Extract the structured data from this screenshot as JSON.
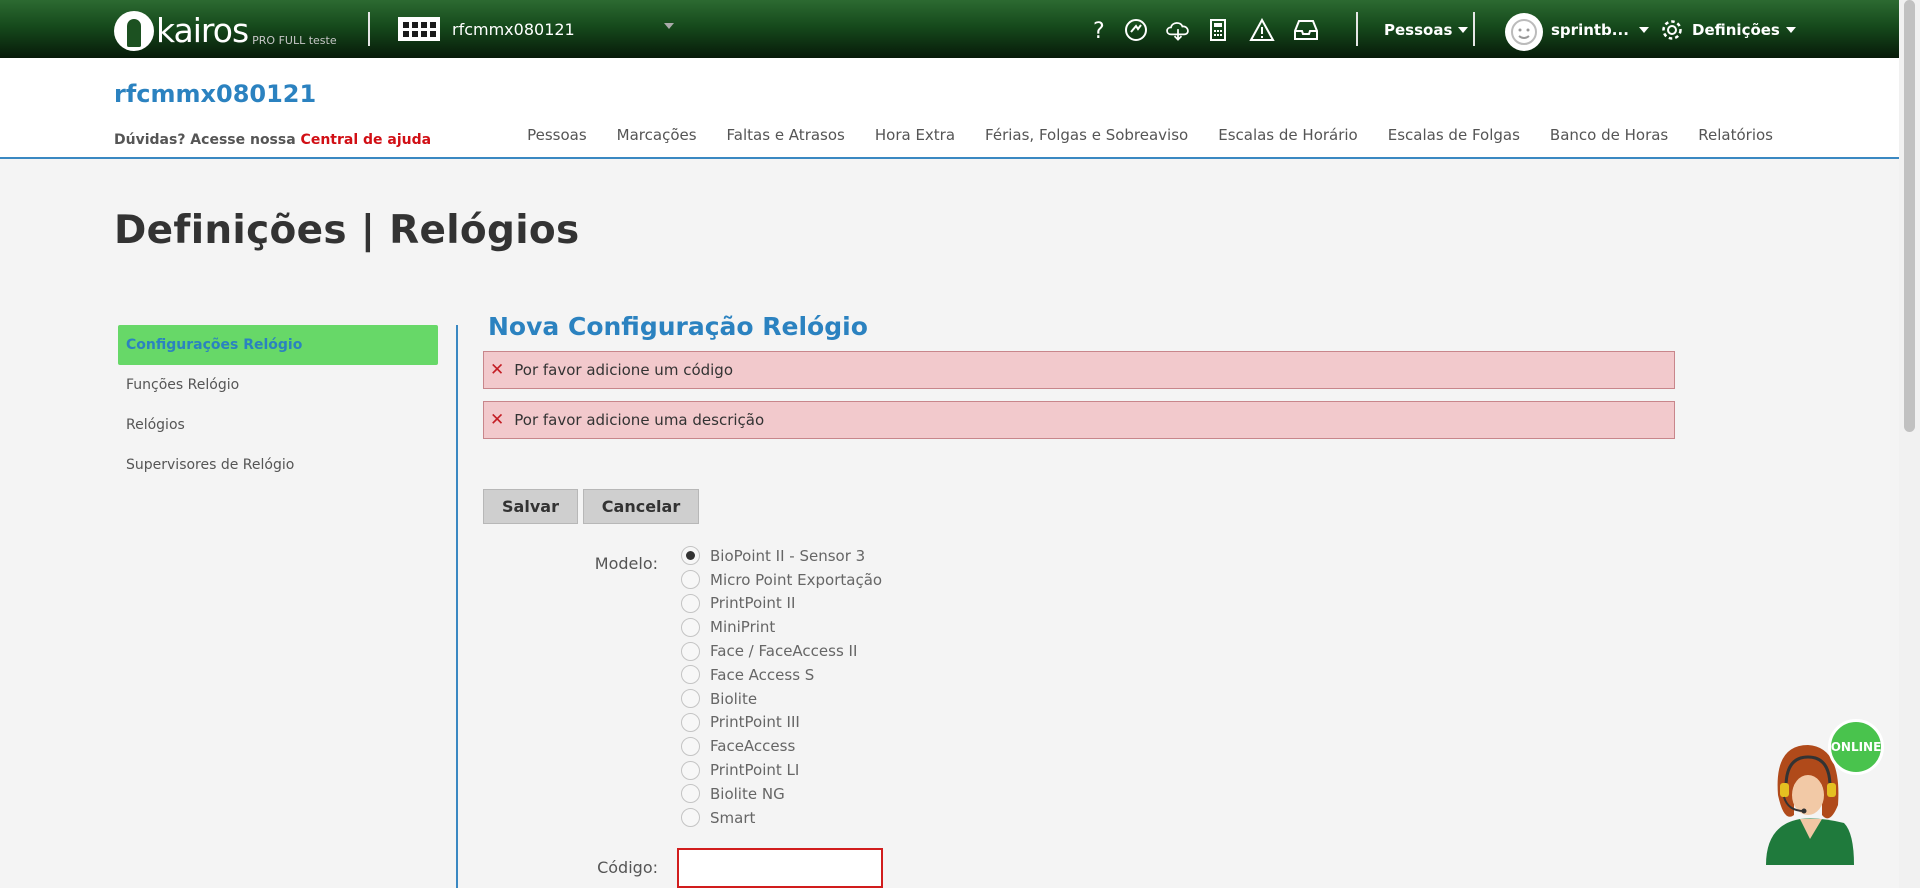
{
  "topbar": {
    "logo_text": "kairos",
    "logo_sub": "PRO FULL teste",
    "company_name": "rfcmmx080121",
    "icons": [
      "help-icon",
      "support-icon",
      "cloud-download-icon",
      "calculator-icon",
      "warning-icon",
      "inbox-icon"
    ],
    "people_menu": "Pessoas",
    "user_name": "sprintb...",
    "settings_menu": "Definições"
  },
  "header": {
    "org_title": "rfcmmx080121",
    "help_prefix": "Dúvidas? Acesse nossa",
    "help_link": "Central de ajuda",
    "nav": [
      "Pessoas",
      "Marcações",
      "Faltas e Atrasos",
      "Hora Extra",
      "Férias, Folgas e Sobreaviso",
      "Escalas de Horário",
      "Escalas de Folgas",
      "Banco de Horas",
      "Relatórios"
    ]
  },
  "page": {
    "title": "Definições | Relógios"
  },
  "sidebar": {
    "items": [
      {
        "label": "Configurações Relógio",
        "active": true
      },
      {
        "label": "Funções Relógio",
        "active": false
      },
      {
        "label": "Relógios",
        "active": false
      },
      {
        "label": "Supervisores de Relógio",
        "active": false
      }
    ]
  },
  "form": {
    "title": "Nova Configuração Relógio",
    "errors": [
      "Por favor adicione um código",
      "Por favor adicione uma descrição"
    ],
    "save_label": "Salvar",
    "cancel_label": "Cancelar",
    "model_label": "Modelo:",
    "models": [
      "BioPoint II - Sensor 3",
      "Micro Point Exportação",
      "PrintPoint II",
      "MiniPrint",
      "Face / FaceAccess II",
      "Face Access S",
      "Biolite",
      "PrintPoint III",
      "FaceAccess",
      "PrintPoint LI",
      "Biolite NG",
      "Smart"
    ],
    "selected_model": "BioPoint II - Sensor 3",
    "code_label": "Código:",
    "code_value": ""
  },
  "chat": {
    "status": "ONLINE"
  },
  "colors": {
    "accent_blue": "#2b82c0",
    "active_green": "#67d868",
    "error_bg": "#f2c9cc",
    "error_red": "#d10f15",
    "topbar_green": "#164a1c"
  }
}
